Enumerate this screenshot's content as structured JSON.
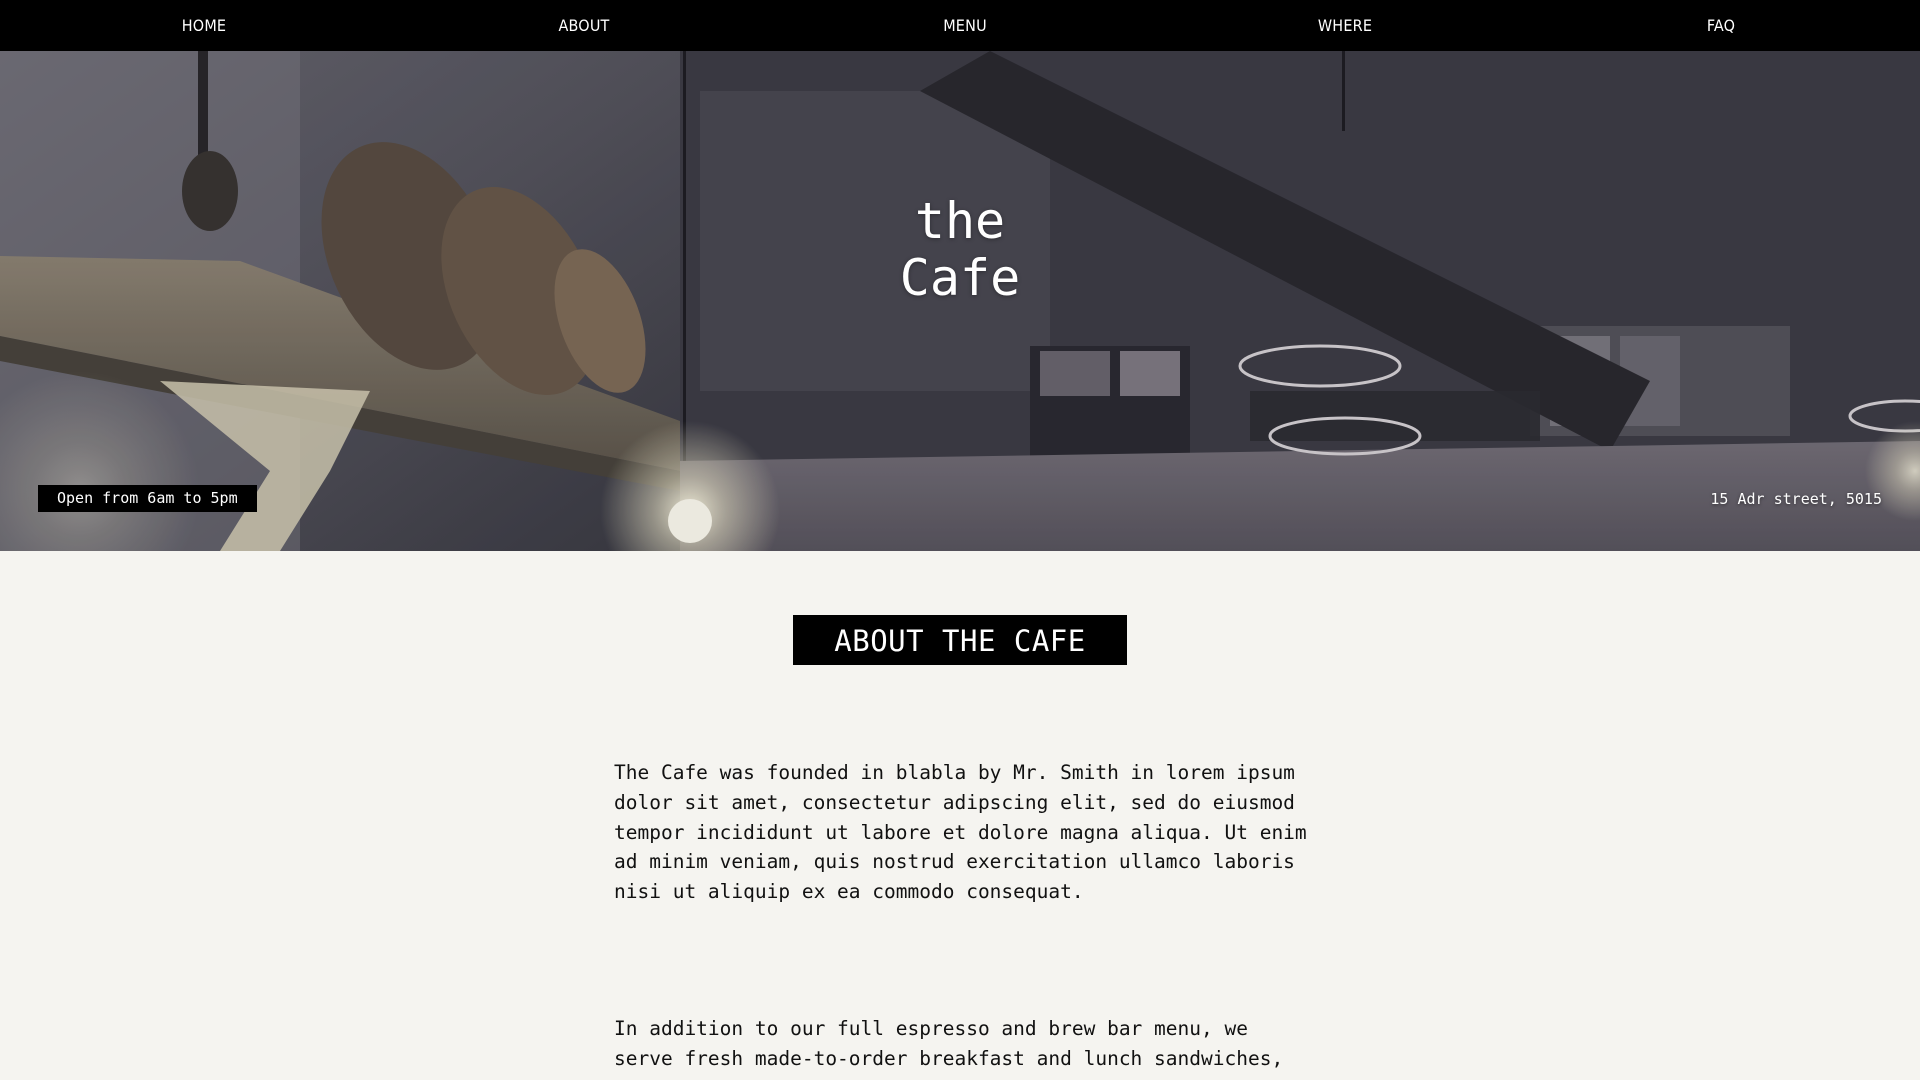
{
  "nav": {
    "items": [
      "HOME",
      "ABOUT",
      "MENU",
      "WHERE",
      "FAQ"
    ]
  },
  "hero": {
    "title_line1": "the",
    "title_line2": "Cafe",
    "hours": "Open from 6am to 5pm",
    "address": "15 Adr street, 5015"
  },
  "about": {
    "heading": "ABOUT THE CAFE",
    "paragraphs": [
      "The Cafe was founded in blabla by Mr. Smith in lorem ipsum dolor sit amet, consectetur adipscing elit, sed do eiusmod tempor incididunt ut labore et dolore magna aliqua. Ut enim ad minim veniam, quis nostrud exercitation ullamco laboris nisi ut aliquip ex ea commodo consequat.",
      "In addition to our full espresso and brew bar menu, we serve fresh made-to-order breakfast and lunch sandwiches,"
    ]
  },
  "colors": {
    "nav_bg": "#000000",
    "page_bg": "#f5f4f0",
    "text": "#111111",
    "badge_bg": "#000000"
  }
}
